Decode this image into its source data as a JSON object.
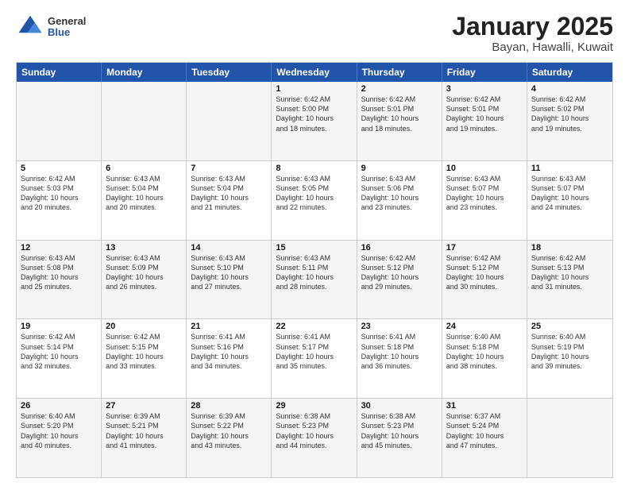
{
  "logo": {
    "general": "General",
    "blue": "Blue"
  },
  "title": "January 2025",
  "location": "Bayan, Hawalli, Kuwait",
  "days": [
    "Sunday",
    "Monday",
    "Tuesday",
    "Wednesday",
    "Thursday",
    "Friday",
    "Saturday"
  ],
  "weeks": [
    [
      {
        "day": "",
        "text": ""
      },
      {
        "day": "",
        "text": ""
      },
      {
        "day": "",
        "text": ""
      },
      {
        "day": "1",
        "text": "Sunrise: 6:42 AM\nSunset: 5:00 PM\nDaylight: 10 hours\nand 18 minutes."
      },
      {
        "day": "2",
        "text": "Sunrise: 6:42 AM\nSunset: 5:01 PM\nDaylight: 10 hours\nand 18 minutes."
      },
      {
        "day": "3",
        "text": "Sunrise: 6:42 AM\nSunset: 5:01 PM\nDaylight: 10 hours\nand 19 minutes."
      },
      {
        "day": "4",
        "text": "Sunrise: 6:42 AM\nSunset: 5:02 PM\nDaylight: 10 hours\nand 19 minutes."
      }
    ],
    [
      {
        "day": "5",
        "text": "Sunrise: 6:42 AM\nSunset: 5:03 PM\nDaylight: 10 hours\nand 20 minutes."
      },
      {
        "day": "6",
        "text": "Sunrise: 6:43 AM\nSunset: 5:04 PM\nDaylight: 10 hours\nand 20 minutes."
      },
      {
        "day": "7",
        "text": "Sunrise: 6:43 AM\nSunset: 5:04 PM\nDaylight: 10 hours\nand 21 minutes."
      },
      {
        "day": "8",
        "text": "Sunrise: 6:43 AM\nSunset: 5:05 PM\nDaylight: 10 hours\nand 22 minutes."
      },
      {
        "day": "9",
        "text": "Sunrise: 6:43 AM\nSunset: 5:06 PM\nDaylight: 10 hours\nand 23 minutes."
      },
      {
        "day": "10",
        "text": "Sunrise: 6:43 AM\nSunset: 5:07 PM\nDaylight: 10 hours\nand 23 minutes."
      },
      {
        "day": "11",
        "text": "Sunrise: 6:43 AM\nSunset: 5:07 PM\nDaylight: 10 hours\nand 24 minutes."
      }
    ],
    [
      {
        "day": "12",
        "text": "Sunrise: 6:43 AM\nSunset: 5:08 PM\nDaylight: 10 hours\nand 25 minutes."
      },
      {
        "day": "13",
        "text": "Sunrise: 6:43 AM\nSunset: 5:09 PM\nDaylight: 10 hours\nand 26 minutes."
      },
      {
        "day": "14",
        "text": "Sunrise: 6:43 AM\nSunset: 5:10 PM\nDaylight: 10 hours\nand 27 minutes."
      },
      {
        "day": "15",
        "text": "Sunrise: 6:43 AM\nSunset: 5:11 PM\nDaylight: 10 hours\nand 28 minutes."
      },
      {
        "day": "16",
        "text": "Sunrise: 6:42 AM\nSunset: 5:12 PM\nDaylight: 10 hours\nand 29 minutes."
      },
      {
        "day": "17",
        "text": "Sunrise: 6:42 AM\nSunset: 5:12 PM\nDaylight: 10 hours\nand 30 minutes."
      },
      {
        "day": "18",
        "text": "Sunrise: 6:42 AM\nSunset: 5:13 PM\nDaylight: 10 hours\nand 31 minutes."
      }
    ],
    [
      {
        "day": "19",
        "text": "Sunrise: 6:42 AM\nSunset: 5:14 PM\nDaylight: 10 hours\nand 32 minutes."
      },
      {
        "day": "20",
        "text": "Sunrise: 6:42 AM\nSunset: 5:15 PM\nDaylight: 10 hours\nand 33 minutes."
      },
      {
        "day": "21",
        "text": "Sunrise: 6:41 AM\nSunset: 5:16 PM\nDaylight: 10 hours\nand 34 minutes."
      },
      {
        "day": "22",
        "text": "Sunrise: 6:41 AM\nSunset: 5:17 PM\nDaylight: 10 hours\nand 35 minutes."
      },
      {
        "day": "23",
        "text": "Sunrise: 6:41 AM\nSunset: 5:18 PM\nDaylight: 10 hours\nand 36 minutes."
      },
      {
        "day": "24",
        "text": "Sunrise: 6:40 AM\nSunset: 5:18 PM\nDaylight: 10 hours\nand 38 minutes."
      },
      {
        "day": "25",
        "text": "Sunrise: 6:40 AM\nSunset: 5:19 PM\nDaylight: 10 hours\nand 39 minutes."
      }
    ],
    [
      {
        "day": "26",
        "text": "Sunrise: 6:40 AM\nSunset: 5:20 PM\nDaylight: 10 hours\nand 40 minutes."
      },
      {
        "day": "27",
        "text": "Sunrise: 6:39 AM\nSunset: 5:21 PM\nDaylight: 10 hours\nand 41 minutes."
      },
      {
        "day": "28",
        "text": "Sunrise: 6:39 AM\nSunset: 5:22 PM\nDaylight: 10 hours\nand 43 minutes."
      },
      {
        "day": "29",
        "text": "Sunrise: 6:38 AM\nSunset: 5:23 PM\nDaylight: 10 hours\nand 44 minutes."
      },
      {
        "day": "30",
        "text": "Sunrise: 6:38 AM\nSunset: 5:23 PM\nDaylight: 10 hours\nand 45 minutes."
      },
      {
        "day": "31",
        "text": "Sunrise: 6:37 AM\nSunset: 5:24 PM\nDaylight: 10 hours\nand 47 minutes."
      },
      {
        "day": "",
        "text": ""
      }
    ]
  ]
}
